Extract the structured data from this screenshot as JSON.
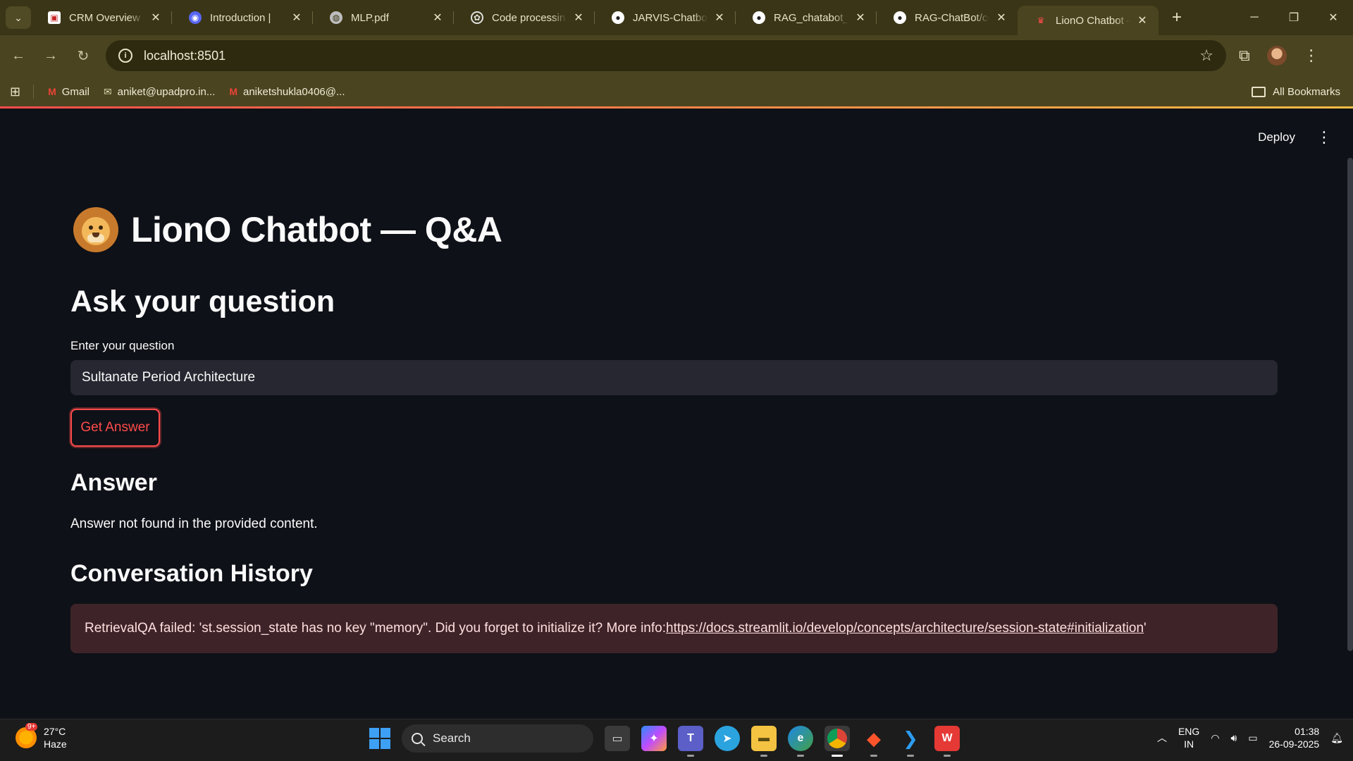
{
  "browser": {
    "tabs": [
      {
        "title": "CRM Overview |",
        "icon": "crm-icon",
        "color": "#ffffff"
      },
      {
        "title": "Introduction |",
        "icon": "discord-icon",
        "color": "#5865f2"
      },
      {
        "title": "MLP.pdf",
        "icon": "globe-icon",
        "color": "#bdbdbd"
      },
      {
        "title": "Code processing",
        "icon": "openai-icon",
        "color": "#e0e0e0"
      },
      {
        "title": "JARVIS-Chatbot-",
        "icon": "github-icon",
        "color": "#ffffff"
      },
      {
        "title": "RAG_chatabot_w",
        "icon": "github-icon",
        "color": "#ffffff"
      },
      {
        "title": "RAG-ChatBot/co",
        "icon": "github-icon",
        "color": "#ffffff"
      },
      {
        "title": "LionO Chatbot —",
        "icon": "streamlit-icon",
        "color": "#ff4b4b"
      }
    ],
    "url": "localhost:8501",
    "bookmarks": [
      {
        "label": "Gmail",
        "icon": "gmail-icon"
      },
      {
        "label": "aniket@upadpro.in...",
        "icon": "mail-icon"
      },
      {
        "label": "aniketshukla0406@...",
        "icon": "gmail-icon"
      }
    ],
    "all_bookmarks_label": "All Bookmarks"
  },
  "app": {
    "deploy_label": "Deploy",
    "title": "LionO Chatbot — Q&A",
    "ask_heading": "Ask your question",
    "input_label": "Enter your question",
    "input_value": "Sultanate Period Architecture",
    "button_label": "Get Answer",
    "answer_heading": "Answer",
    "answer_text": "Answer not found in the provided content.",
    "history_heading": "Conversation History",
    "error_prefix": "RetrievalQA failed: 'st.session_state has no key \"memory\". Did you forget to initialize it? More info: ",
    "error_link": "https://docs.streamlit.io/develop/concepts/architecture/session-state#initialization",
    "error_suffix": "'",
    "colors": {
      "accent": "#ff4b4b",
      "background": "#0e1117",
      "input_bg": "#262730",
      "error_bg": "#3e2428"
    }
  },
  "taskbar": {
    "temperature": "27°C",
    "weather": "Haze",
    "weather_badge": "9+",
    "search_placeholder": "Search",
    "lang_top": "ENG",
    "lang_bottom": "IN",
    "time": "01:38",
    "date": "26-09-2025"
  }
}
